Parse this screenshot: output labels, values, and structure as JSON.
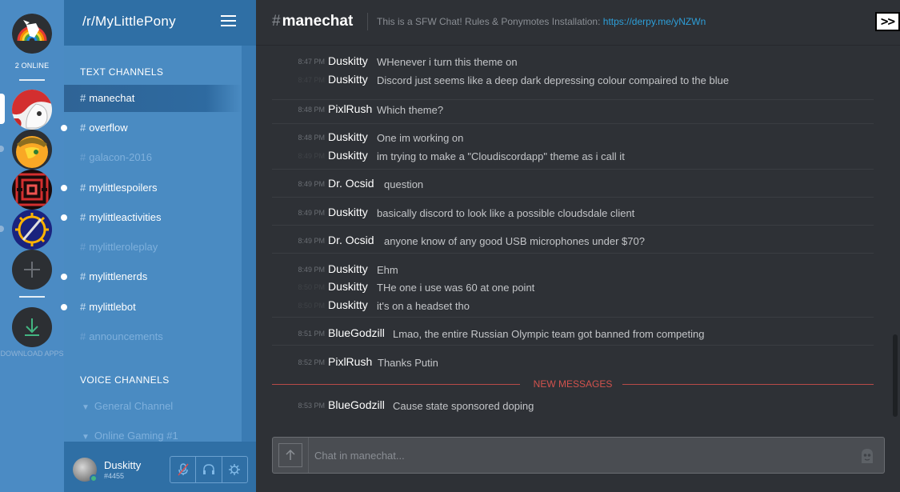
{
  "servers": {
    "online_count": "2 ONLINE",
    "items": [
      {
        "name": "mylittlepony-server",
        "icon": "rainbow-pony-icon"
      },
      {
        "name": "red-pony-server",
        "icon": "red-pony-avatar"
      },
      {
        "name": "applejack-server",
        "icon": "applejack-avatar"
      },
      {
        "name": "red-maze-server",
        "icon": "red-maze-avatar"
      },
      {
        "name": "sun-sword-server",
        "icon": "sun-sword-avatar"
      }
    ],
    "add_server_icon": "plus-icon",
    "download_label": "DOWNLOAD APPS",
    "download_icon": "download-icon"
  },
  "guild": {
    "name": "/r/MyLittlePony",
    "menu_icon": "hamburger-icon"
  },
  "text_category": "TEXT CHANNELS",
  "text_channels": [
    {
      "name": "manechat",
      "state": "active"
    },
    {
      "name": "overflow",
      "state": "unread"
    },
    {
      "name": "galacon-2016",
      "state": "muted"
    },
    {
      "name": "mylittlespoilers",
      "state": "unread"
    },
    {
      "name": "mylittleactivities",
      "state": "unread"
    },
    {
      "name": "mylittleroleplay",
      "state": "muted"
    },
    {
      "name": "mylittlenerds",
      "state": "unread"
    },
    {
      "name": "mylittlebot",
      "state": "unread"
    },
    {
      "name": "announcements",
      "state": "muted"
    }
  ],
  "voice_category": "VOICE CHANNELS",
  "voice_channels": [
    {
      "name": "General Channel"
    },
    {
      "name": "Online Gaming #1"
    }
  ],
  "user": {
    "name": "Duskitty",
    "tag": "#4455",
    "status_color": "#43b581",
    "controls": [
      "mute-mic-icon",
      "headphones-icon",
      "gear-icon"
    ]
  },
  "chat": {
    "hash": "#",
    "channel": "manechat",
    "topic": "This is a SFW Chat! Rules & Ponymotes Installation: ",
    "topic_link": "https://derpy.me/yNZWn",
    "extra_button": ">>",
    "composer_placeholder": "Chat in manechat...",
    "new_messages_label": "NEW MESSAGES"
  },
  "messages": [
    {
      "lines": [
        {
          "time": "8:47 PM",
          "author": "Duskitty",
          "text": "WHenever i turn this theme on"
        },
        {
          "time": "8:47 PM",
          "author": "Duskitty",
          "text": "Discord just seems like a deep dark depressing colour compaired to the blue"
        }
      ]
    },
    {
      "lines": [
        {
          "time": "8:48 PM",
          "author": "PixlRush",
          "text": "Which theme?"
        }
      ]
    },
    {
      "lines": [
        {
          "time": "8:48 PM",
          "author": "Duskitty",
          "text": "One im working on"
        },
        {
          "time": "8:49 PM",
          "author": "Duskitty",
          "text": "im trying to make a \"Cloudiscordapp\" theme as i call it"
        }
      ]
    },
    {
      "lines": [
        {
          "time": "8:49 PM",
          "author": "Dr. Ocsid",
          "text": "question"
        }
      ]
    },
    {
      "lines": [
        {
          "time": "8:49 PM",
          "author": "Duskitty",
          "text": "basically discord to look like a possible cloudsdale client"
        }
      ]
    },
    {
      "lines": [
        {
          "time": "8:49 PM",
          "author": "Dr. Ocsid",
          "text": "anyone know of any good USB microphones under $70?"
        }
      ]
    },
    {
      "lines": [
        {
          "time": "8:49 PM",
          "author": "Duskitty",
          "text": "Ehm"
        },
        {
          "time": "8:50 PM",
          "author": "Duskitty",
          "text": "THe one i use was 60 at one point"
        },
        {
          "time": "8:50 PM",
          "author": "Duskitty",
          "text": "it's on a headset tho"
        }
      ]
    },
    {
      "lines": [
        {
          "time": "8:51 PM",
          "author": "BlueGodzill",
          "text": "Lmao, the entire Russian Olympic team got banned from competing"
        }
      ]
    },
    {
      "lines": [
        {
          "time": "8:52 PM",
          "author": "PixlRush",
          "text": "Thanks Putin"
        }
      ]
    },
    {
      "lines": [
        {
          "time": "8:53 PM",
          "author": "BlueGodzill",
          "text": "Cause state sponsored doping"
        }
      ]
    }
  ]
}
